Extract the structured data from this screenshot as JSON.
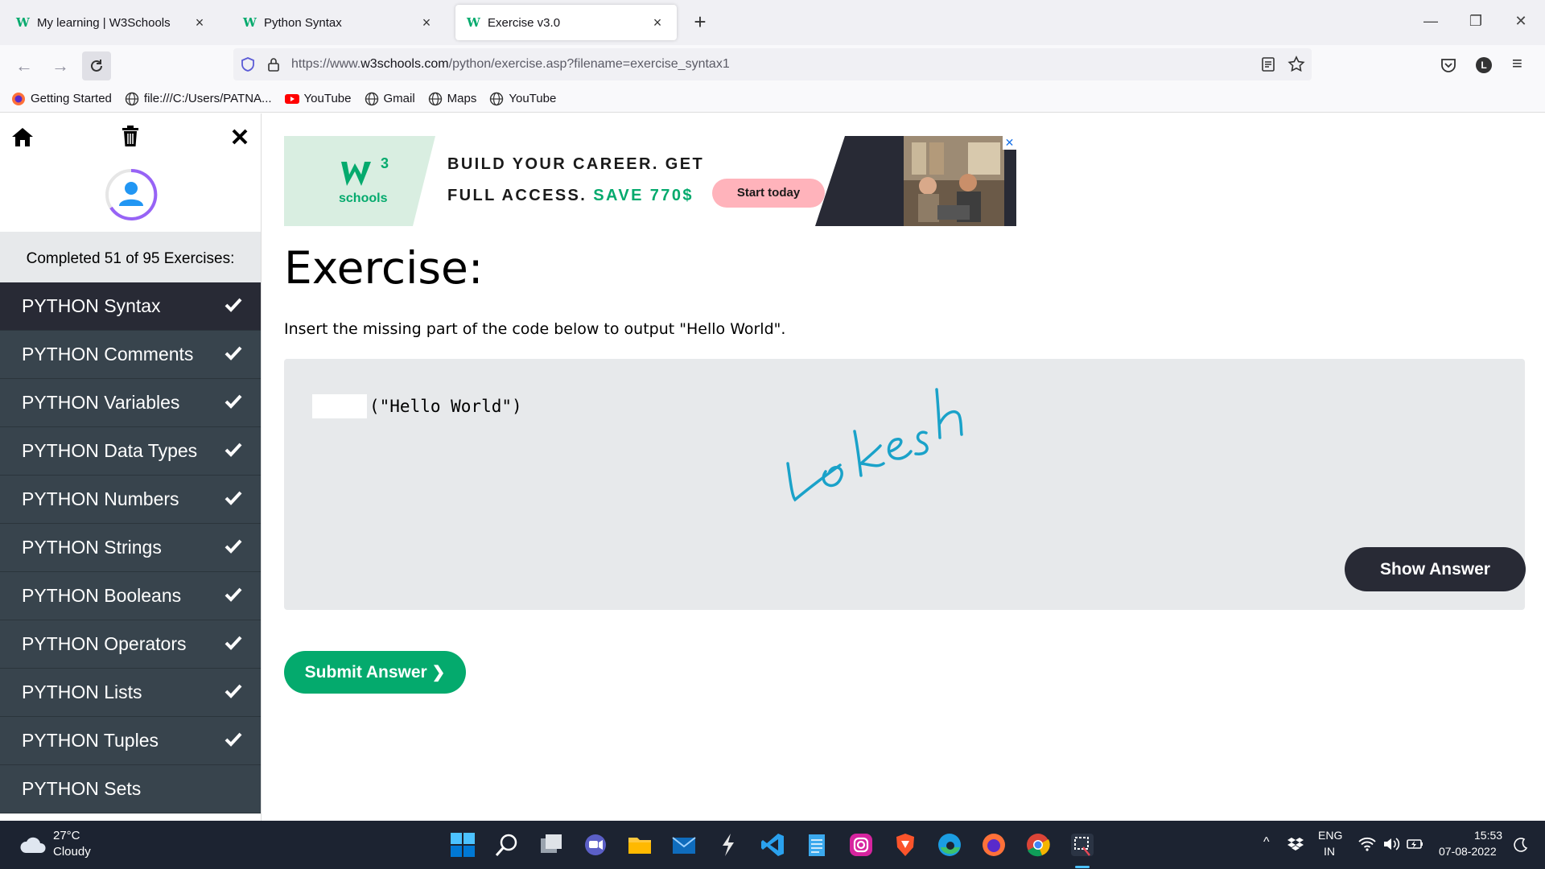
{
  "browser": {
    "tabs": [
      {
        "title": "My learning | W3Schools",
        "active": false
      },
      {
        "title": "Python Syntax",
        "active": false
      },
      {
        "title": "Exercise v3.0",
        "active": true
      }
    ],
    "url": {
      "prefix": "https://www.",
      "domain": "w3schools.com",
      "path": "/python/exercise.asp?filename=exercise_syntax1"
    },
    "profile_initial": "L",
    "bookmarks": [
      {
        "label": "Getting Started",
        "icon": "firefox-icon"
      },
      {
        "label": "file:///C:/Users/PATNA...",
        "icon": "globe-icon"
      },
      {
        "label": "YouTube",
        "icon": "youtube-icon"
      },
      {
        "label": "Gmail",
        "icon": "globe-icon"
      },
      {
        "label": "Maps",
        "icon": "globe-icon"
      },
      {
        "label": "YouTube",
        "icon": "globe-icon"
      }
    ]
  },
  "sidebar": {
    "progress_text": "Completed 51 of 95 Exercises:",
    "items": [
      {
        "label": "PYTHON Syntax",
        "done": true,
        "active": true
      },
      {
        "label": "PYTHON Comments",
        "done": true
      },
      {
        "label": "PYTHON Variables",
        "done": true
      },
      {
        "label": "PYTHON Data Types",
        "done": true
      },
      {
        "label": "PYTHON Numbers",
        "done": true
      },
      {
        "label": "PYTHON Strings",
        "done": true
      },
      {
        "label": "PYTHON Booleans",
        "done": true
      },
      {
        "label": "PYTHON Operators",
        "done": true
      },
      {
        "label": "PYTHON Lists",
        "done": true
      },
      {
        "label": "PYTHON Tuples",
        "done": true
      },
      {
        "label": "PYTHON Sets",
        "done": false
      }
    ]
  },
  "ad": {
    "logo_text": "schools",
    "logo_sup": "3",
    "line1": "BUILD YOUR CAREER. GET",
    "line2_prefix": "FULL ACCESS.",
    "line2_highlight": "SAVE 770$",
    "cta": "Start today"
  },
  "exercise": {
    "title": "Exercise:",
    "description": "Insert the missing part of the code below to output \"Hello World\".",
    "code_after_blank": "(\"Hello World\")",
    "handwriting": "Lokesh",
    "show_answer": "Show Answer",
    "submit": "Submit Answer"
  },
  "taskbar": {
    "weather_temp": "27°C",
    "weather_desc": "Cloudy",
    "lang_top": "ENG",
    "lang_bottom": "IN",
    "time": "15:53",
    "date": "07-08-2022"
  },
  "colors": {
    "w3_green": "#04aa6d",
    "sidebar_dark": "#38444d",
    "sidebar_active": "#282a35",
    "codebox_bg": "#e7e9eb",
    "taskbar_bg": "#1c2331",
    "signature_blue": "#1aa2c9"
  }
}
